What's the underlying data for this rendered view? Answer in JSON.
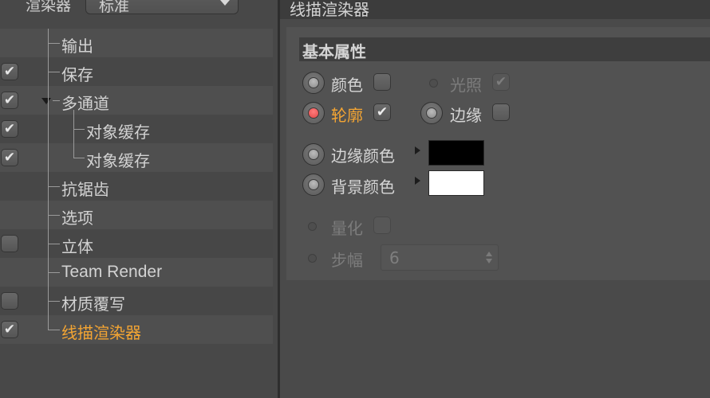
{
  "renderer": {
    "label": "渲染器",
    "value": "标准"
  },
  "tree": {
    "items": [
      {
        "label": "输出"
      },
      {
        "label": "保存",
        "checked": true
      },
      {
        "label": "多通道",
        "checked": true
      },
      {
        "label": "对象缓存",
        "checked": true
      },
      {
        "label": "对象缓存",
        "checked": true
      },
      {
        "label": "抗锯齿"
      },
      {
        "label": "选项"
      },
      {
        "label": "立体",
        "checked": false
      },
      {
        "label": "Team Render"
      },
      {
        "label": "材质覆写",
        "checked": false
      },
      {
        "label": "线描渲染器",
        "checked": true,
        "active": true
      }
    ],
    "check_glyph": "✔"
  },
  "panel": {
    "title": "线描渲染器",
    "group_title": "基本属性",
    "color": {
      "label": "颜色",
      "checked": false
    },
    "illumination": {
      "label": "光照",
      "checked": true,
      "disabled": true
    },
    "outline": {
      "label": "轮廓",
      "checked": true,
      "active": true
    },
    "edges": {
      "label": "边缘",
      "checked": false
    },
    "edge_color": {
      "label": "边缘颜色",
      "value": "#000000"
    },
    "background_color": {
      "label": "背景颜色",
      "value": "#ffffff"
    },
    "quantize": {
      "label": "量化",
      "checked": false,
      "disabled": true
    },
    "steps": {
      "label": "步幅",
      "value": "6",
      "disabled": true
    }
  },
  "colors": {
    "accent_active": "#f4a533",
    "radio_active": "#e04848",
    "panel_bg": "#4a4a4a"
  },
  "icons": {
    "expand": "triangle-down-icon",
    "color_picker": "play-arrow-icon",
    "spinner": "stepper-icon"
  }
}
